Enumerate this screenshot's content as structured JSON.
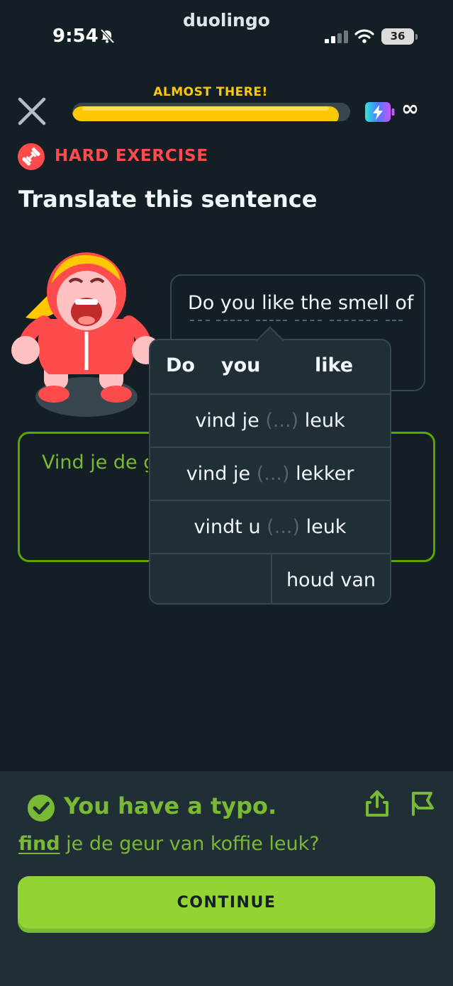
{
  "status_bar": {
    "app_name": "duolingo",
    "time": "9:54",
    "battery": "36",
    "icons": [
      "bell-muted-icon",
      "signal-icon",
      "wifi-icon",
      "battery-icon"
    ]
  },
  "header": {
    "progress_caption": "ALMOST THERE!",
    "progress": 0.96,
    "energy_label": "∞",
    "icons": [
      "close-icon",
      "energy-icon"
    ]
  },
  "exercise": {
    "badge": "HARD EXERCISE",
    "instruction": "Translate this sentence",
    "prompt_sentence": "Do you like the smell of",
    "answer_text": "Vind je de geur van koffie leuk?"
  },
  "hint": {
    "headers": [
      "Do",
      "you",
      "like"
    ],
    "rows": [
      {
        "pre": "vind je",
        "mid": "(...)",
        "post": "leuk"
      },
      {
        "pre": "vind je",
        "mid": "(...)",
        "post": "lekker"
      },
      {
        "pre": "vindt u",
        "mid": "(...)",
        "post": "leuk"
      }
    ],
    "last": "houd van"
  },
  "feedback": {
    "title": "You have a typo.",
    "typo_word": "find",
    "rest": " je de geur van koffie leuk?",
    "continue_label": "CONTINUE",
    "icons": [
      "check-circle-icon",
      "share-icon",
      "flag-icon"
    ]
  },
  "colors": {
    "background": "#131f24",
    "panel": "#202f36",
    "border": "#37464f",
    "progress_yellow": "#ffc800",
    "hard_red": "#ff4b4b",
    "success_green": "#79b933",
    "button_green": "#93d333"
  }
}
